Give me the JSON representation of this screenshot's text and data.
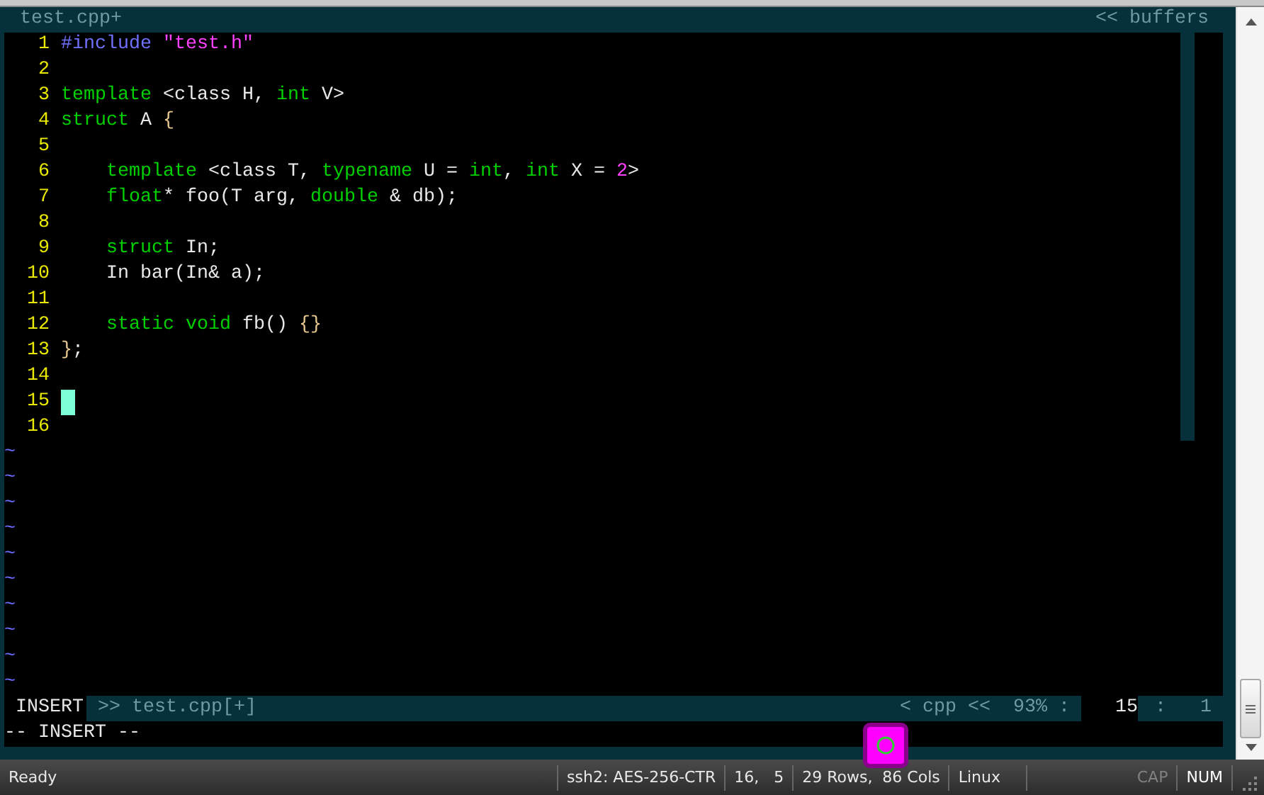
{
  "tabline": {
    "title": "test.cpp+",
    "right": "<< buffers"
  },
  "lines": [
    {
      "number": "1",
      "cursor": false,
      "tokens": [
        {
          "kind": "preproc",
          "text": "#include"
        },
        {
          "kind": "string",
          "text": " \"test.h\""
        }
      ]
    },
    {
      "number": "2",
      "cursor": false
    },
    {
      "number": "3",
      "cursor": false,
      "tokens": [
        {
          "kind": "keyword",
          "text": "template"
        },
        {
          "kind": "plain",
          "text": " <class H, "
        },
        {
          "kind": "keyword",
          "text": "int"
        },
        {
          "kind": "plain",
          "text": " V>"
        }
      ]
    },
    {
      "number": "4",
      "cursor": false,
      "tokens": [
        {
          "kind": "keyword",
          "text": "struct"
        },
        {
          "kind": "plain",
          "text": " A "
        },
        {
          "kind": "brace",
          "text": "{"
        }
      ]
    },
    {
      "number": "5",
      "cursor": false
    },
    {
      "number": "6",
      "cursor": false,
      "tokens": [
        {
          "kind": "keyword",
          "text": "    template"
        },
        {
          "kind": "plain",
          "text": " <class T, "
        },
        {
          "kind": "keyword",
          "text": "typename"
        },
        {
          "kind": "plain",
          "text": " U = "
        },
        {
          "kind": "keyword",
          "text": "int"
        },
        {
          "kind": "plain",
          "text": ", "
        },
        {
          "kind": "keyword",
          "text": "int"
        },
        {
          "kind": "plain",
          "text": " X = "
        },
        {
          "kind": "number",
          "text": "2"
        },
        {
          "kind": "plain",
          "text": ">"
        }
      ]
    },
    {
      "number": "7",
      "cursor": false,
      "tokens": [
        {
          "kind": "keyword",
          "text": "    float"
        },
        {
          "kind": "plain",
          "text": "* foo(T arg, "
        },
        {
          "kind": "keyword",
          "text": "double"
        },
        {
          "kind": "plain",
          "text": " & db);"
        }
      ]
    },
    {
      "number": "8",
      "cursor": false
    },
    {
      "number": "9",
      "cursor": false,
      "tokens": [
        {
          "kind": "keyword",
          "text": "    struct"
        },
        {
          "kind": "plain",
          "text": " In;"
        }
      ]
    },
    {
      "number": "10",
      "cursor": false,
      "tokens": [
        {
          "kind": "plain",
          "text": "    In bar(In& a);"
        }
      ]
    },
    {
      "number": "11",
      "cursor": false
    },
    {
      "number": "12",
      "cursor": false,
      "tokens": [
        {
          "kind": "keyword",
          "text": "    static void"
        },
        {
          "kind": "plain",
          "text": " fb() "
        },
        {
          "kind": "brace",
          "text": "{}"
        }
      ]
    },
    {
      "number": "13",
      "cursor": false,
      "tokens": [
        {
          "kind": "brace",
          "text": "}"
        },
        {
          "kind": "plain",
          "text": ";"
        }
      ]
    },
    {
      "number": "14",
      "cursor": false
    },
    {
      "number": "15",
      "cursor": true
    },
    {
      "number": "16",
      "cursor": false
    }
  ],
  "tilde_rows": [
    "~",
    "~",
    "~",
    "~",
    "~",
    "~",
    "~",
    "~",
    "~",
    "~"
  ],
  "statusline": {
    "mode": "INSERT",
    "file": ">> test.cpp[+]",
    "filetype": "< cpp <<",
    "percent": "93% :",
    "line": "15",
    "col": ":   1"
  },
  "cmdline": "-- INSERT --",
  "status_bar": [
    {
      "text": "Ready"
    },
    {
      "text": "ssh2: AES-256-CTR"
    },
    {
      "text": "16,   5"
    },
    {
      "text": "29 Rows,  86 Cols"
    },
    {
      "text": "Linux"
    },
    {
      "text": "CAP",
      "on": false
    },
    {
      "text": "NUM",
      "on": true
    }
  ]
}
